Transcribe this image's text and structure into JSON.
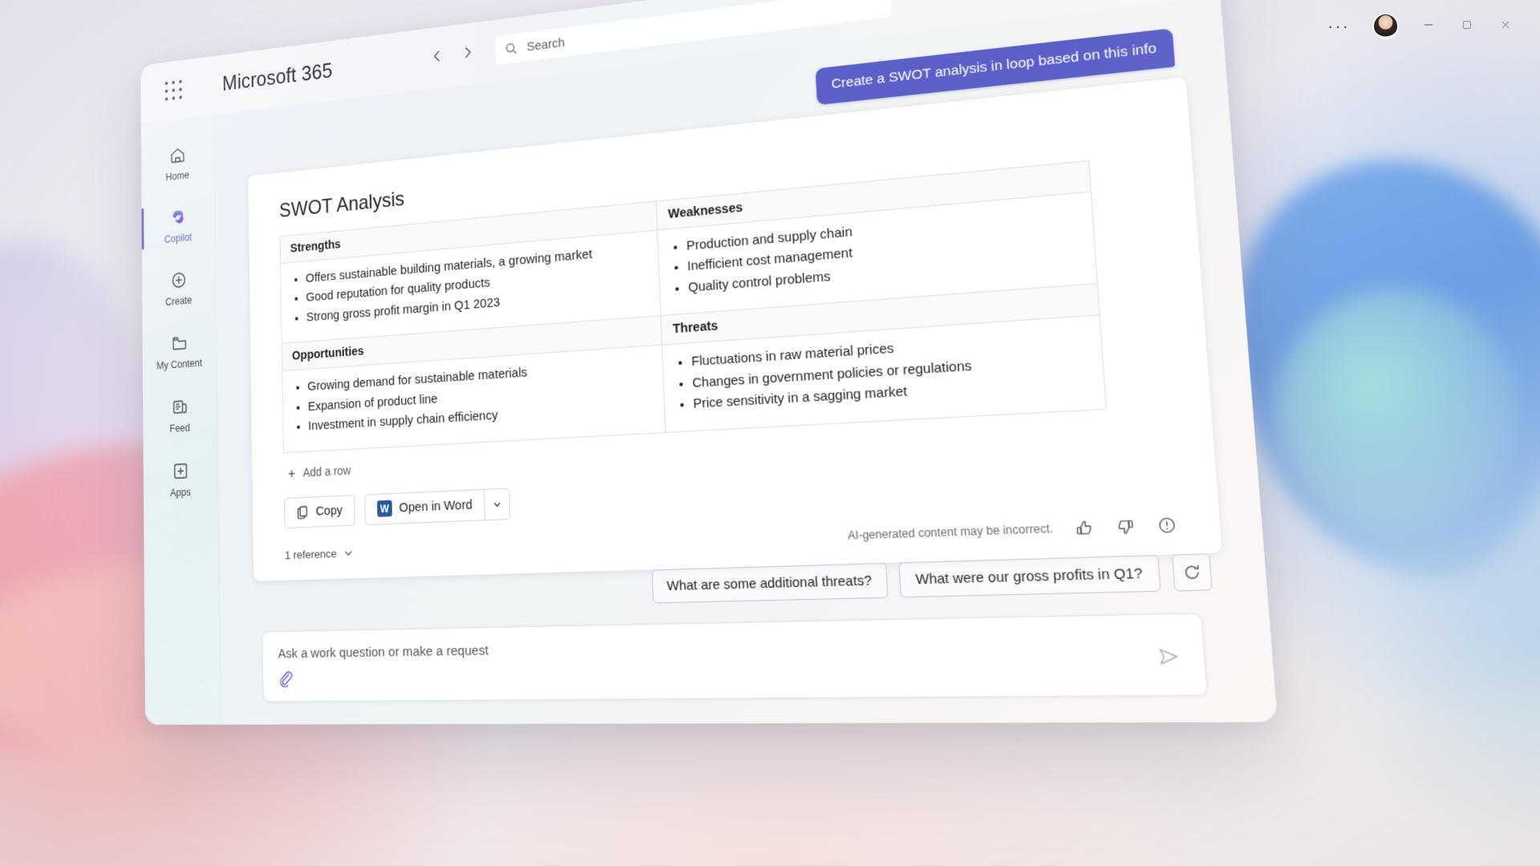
{
  "app": {
    "brand": "Microsoft 365",
    "waffle_icon": "app-launcher-icon",
    "back_icon": "chevron-left-icon",
    "forward_icon": "chevron-right-icon"
  },
  "search": {
    "placeholder": "Search",
    "icon": "search-icon"
  },
  "window_controls": {
    "more_label": "···",
    "avatar_name": "avatar",
    "minimize_label": "–",
    "maximize_label": "☐",
    "close_label": "✕"
  },
  "sidebar": {
    "items": [
      {
        "label": "Home",
        "icon": "home-icon",
        "active": false
      },
      {
        "label": "Copilot",
        "icon": "copilot-icon",
        "active": true
      },
      {
        "label": "Create",
        "icon": "plus-circle-icon",
        "active": false
      },
      {
        "label": "My Content",
        "icon": "folder-icon",
        "active": false
      },
      {
        "label": "Feed",
        "icon": "feed-icon",
        "active": false
      },
      {
        "label": "Apps",
        "icon": "apps-plus-icon",
        "active": false
      }
    ]
  },
  "conversation": {
    "user_message": "Create a SWOT analysis in loop based on this info",
    "card": {
      "title": "SWOT Analysis",
      "quadrants": [
        {
          "header": "Strengths",
          "items": [
            "Offers sustainable building materials, a growing market",
            "Good reputation for quality products",
            "Strong gross profit margin in Q1 2023"
          ]
        },
        {
          "header": "Weaknesses",
          "items": [
            "Production and supply chain",
            "Inefficient cost management",
            "Quality control problems"
          ]
        },
        {
          "header": "Opportunities",
          "items": [
            "Growing demand for sustainable materials",
            "Expansion of product line",
            "Investment in supply chain efficiency"
          ]
        },
        {
          "header": "Threats",
          "items": [
            "Fluctuations in raw material prices",
            "Changes in government policies or regulations",
            "Price sensitivity in a sagging market"
          ]
        }
      ],
      "add_row_label": "Add a row",
      "copy_label": "Copy",
      "open_in_word_label": "Open in Word",
      "word_logo_letter": "W",
      "references_label": "1 reference",
      "disclaimer": "AI-generated content may be incorrect.",
      "feedback": {
        "like_icon": "thumbs-up-icon",
        "dislike_icon": "thumbs-down-icon",
        "report_icon": "report-icon"
      }
    },
    "suggestions": [
      "What are some additional threats?",
      "What were our gross profits in Q1?"
    ],
    "refresh_icon": "refresh-icon"
  },
  "composer": {
    "placeholder": "Ask a work question or make a request",
    "attach_icon": "paperclip-icon",
    "send_icon": "send-icon"
  },
  "colors": {
    "accent": "#5b5fc7",
    "user_bubble": "#5b5fc7",
    "word_blue": "#2b579a"
  }
}
